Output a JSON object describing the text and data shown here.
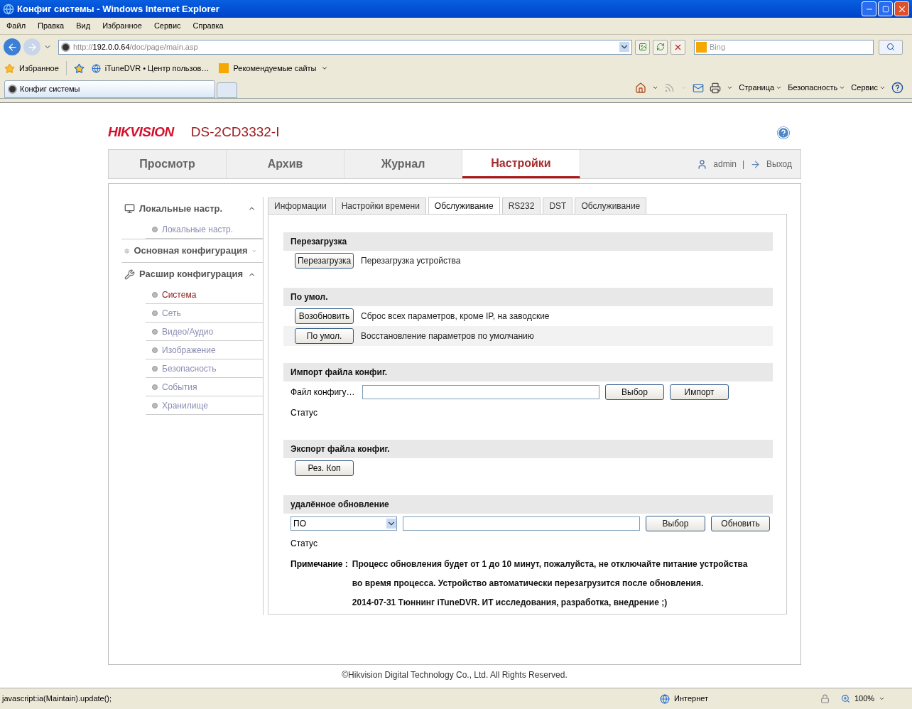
{
  "window": {
    "title": "Конфиг системы - Windows Internet Explorer"
  },
  "menu": [
    "Файл",
    "Правка",
    "Вид",
    "Избранное",
    "Сервис",
    "Справка"
  ],
  "address": {
    "scheme": "http://",
    "host": "192.0.0.64",
    "path": "/doc/page/main.asp"
  },
  "search": {
    "placeholder": "Bing"
  },
  "favorites": {
    "label": "Избранное",
    "links": [
      "iTuneDVR • Центр пользов…",
      "Рекомендуемые сайты"
    ]
  },
  "browser_tabs": [
    {
      "label": "Конфиг системы",
      "selected": true
    }
  ],
  "command_bar": [
    "Страница",
    "Безопасность",
    "Сервис"
  ],
  "page": {
    "brand": "HIKVISION",
    "model": "DS-2CD3332-I",
    "nav": [
      {
        "label": "Просмотр",
        "selected": false
      },
      {
        "label": "Архив",
        "selected": false
      },
      {
        "label": "Журнал",
        "selected": false
      },
      {
        "label": "Настройки",
        "selected": true
      }
    ],
    "user": "admin",
    "separator": "|",
    "logout": "Выход",
    "sidebar": [
      {
        "label": "Локальные настр.",
        "kind": "monitor",
        "expanded": true,
        "children": [
          {
            "label": "Локальные настр.",
            "selected": false
          }
        ]
      },
      {
        "label": "Основная конфигурация",
        "kind": "gear",
        "expanded": false
      },
      {
        "label": "Расшир конфигурация",
        "kind": "wrench",
        "expanded": true,
        "children": [
          {
            "label": "Система",
            "selected": true
          },
          {
            "label": "Сеть",
            "selected": false
          },
          {
            "label": "Видео/Аудио",
            "selected": false
          },
          {
            "label": "Изображение",
            "selected": false
          },
          {
            "label": "Безопасность",
            "selected": false
          },
          {
            "label": "События",
            "selected": false
          },
          {
            "label": "Хранилище",
            "selected": false
          }
        ]
      }
    ],
    "subtabs": [
      {
        "label": "Информации",
        "selected": false
      },
      {
        "label": "Настройки времени",
        "selected": false
      },
      {
        "label": "Обслуживание",
        "selected": true
      },
      {
        "label": "RS232",
        "selected": false
      },
      {
        "label": "DST",
        "selected": false
      },
      {
        "label": "Обслуживание",
        "selected": false
      }
    ],
    "sections": [
      {
        "title": "Перезагрузка",
        "rows": [
          {
            "kind": "action",
            "button": "Перезагрузка",
            "text": "Перезагрузка устройства",
            "shaded": false
          }
        ]
      },
      {
        "title": "По умол.",
        "rows": [
          {
            "kind": "action",
            "button": "Возобновить",
            "text": "Сброс всех параметров, кроме IP, на заводские",
            "shaded": false
          },
          {
            "kind": "action",
            "button": "По умол.",
            "text": "Восстановление параметров по умолчанию",
            "shaded": true
          }
        ]
      },
      {
        "title": "Импорт файла конфиг.",
        "rows": [
          {
            "kind": "file",
            "label": "Файл конфигу…",
            "buttons": [
              "Выбор",
              "Импорт"
            ]
          },
          {
            "kind": "status",
            "text": "Статус"
          }
        ]
      },
      {
        "title": "Экспорт файла конфиг.",
        "rows": [
          {
            "kind": "action",
            "button": "Рез. Коп",
            "shaded": false
          }
        ]
      },
      {
        "title": "удалённое обновление",
        "rows": [
          {
            "kind": "select_file",
            "value": "ПО",
            "buttons": [
              "Выбор",
              "Обновить"
            ]
          },
          {
            "kind": "status",
            "text": "Статус"
          },
          {
            "kind": "note",
            "label": "Примечание :",
            "lines": [
              "Процесс обновления будет от 1 до 10 минут, пожалуйста, не отключайте питание устройства",
              "во время процесса. Устройство автоматически перезагрузится после обновления.",
              "2014-07-31 Тюннинг iTuneDVR. ИТ исследования, разработка, внедрение ;)"
            ]
          }
        ]
      }
    ],
    "footer": "©Hikvision Digital Technology Co., Ltd. All Rights Reserved."
  },
  "status_bar": {
    "text": "javascript:ia(Maintain).update();",
    "zone": "Интернет",
    "zoom": "100%"
  }
}
